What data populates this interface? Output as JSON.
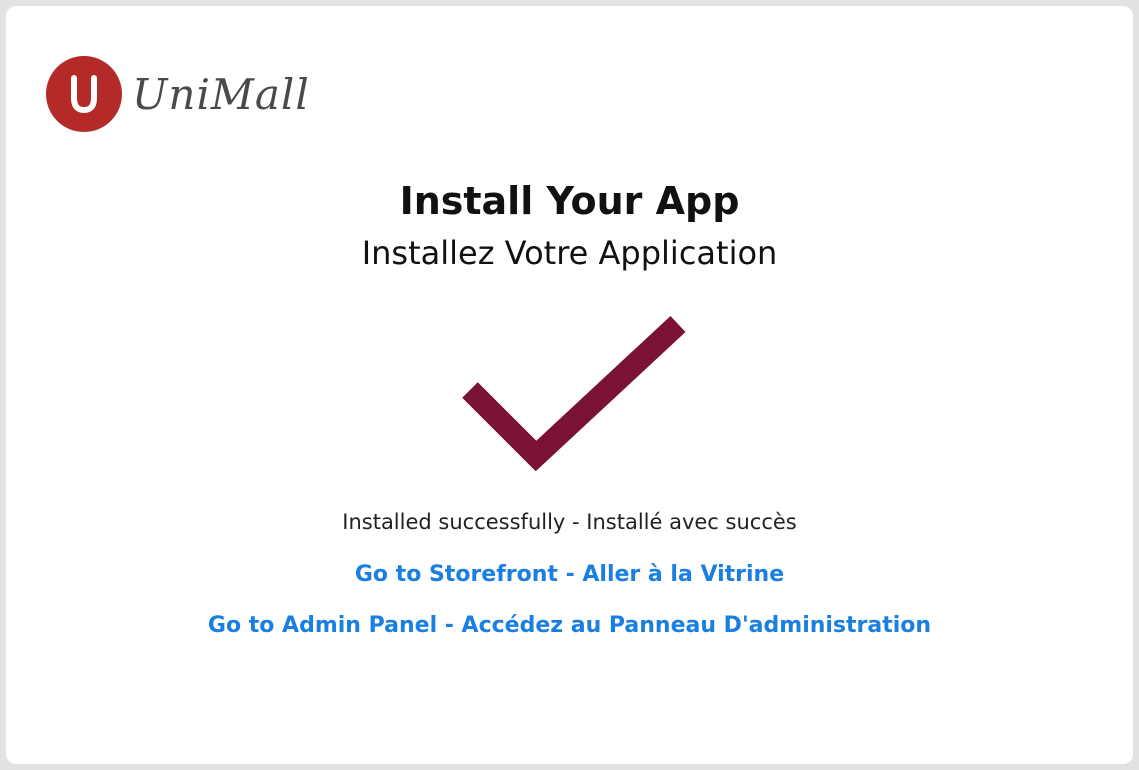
{
  "brand": {
    "name": "UniMall",
    "mark_letter": "U",
    "mark_color": "#b32a28"
  },
  "header": {
    "title": "Install Your App",
    "subtitle": "Installez Votre Application"
  },
  "status": {
    "icon": "checkmark-icon",
    "icon_color": "#7a1238",
    "message": "Installed successfully - Installé avec succès"
  },
  "links": {
    "storefront": "Go to Storefront - Aller à la Vitrine",
    "admin_panel": "Go to Admin Panel - Accédez au Panneau D'administration",
    "link_color": "#1a7fe0"
  }
}
